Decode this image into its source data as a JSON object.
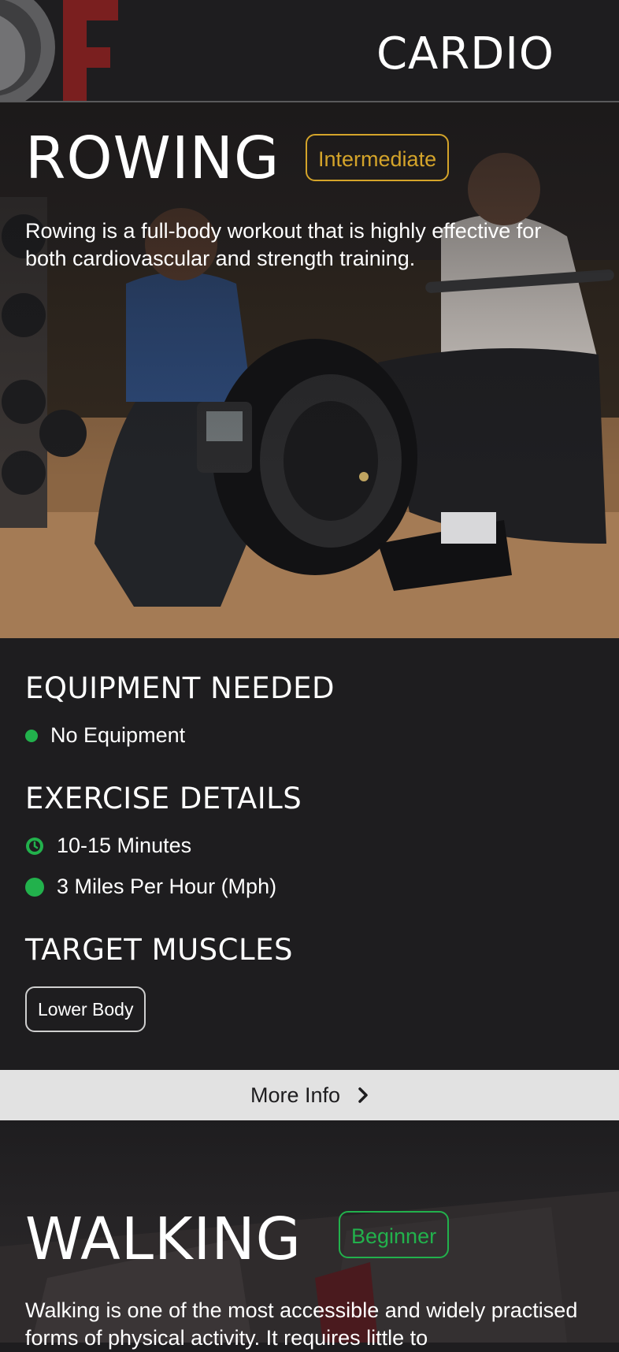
{
  "header": {
    "title": "CARDIO"
  },
  "exercises": [
    {
      "title": "ROWING",
      "level": "Intermediate",
      "level_color": "#d4a42a",
      "description": "Rowing is a full-body workout that is highly effective for both cardiovascular and strength training.",
      "equipment_heading": "EQUIPMENT NEEDED",
      "equipment": [
        "No Equipment"
      ],
      "details_heading": "EXERCISE DETAILS",
      "details": [
        {
          "icon": "clock-icon",
          "text": "10-15 Minutes"
        },
        {
          "icon": "dot-icon",
          "text": "3 Miles Per Hour (Mph)"
        }
      ],
      "muscles_heading": "TARGET MUSCLES",
      "muscles": [
        "Lower Body"
      ],
      "more_info_label": "More Info"
    },
    {
      "title": "WALKING",
      "level": "Beginner",
      "level_color": "#22b14c",
      "description": "Walking is one of the most accessible and widely practised forms of physical activity. It requires little to"
    }
  ],
  "colors": {
    "accent_green": "#22b14c",
    "background": "#1e1d1f",
    "more_info_bg": "#e2e2e2"
  }
}
